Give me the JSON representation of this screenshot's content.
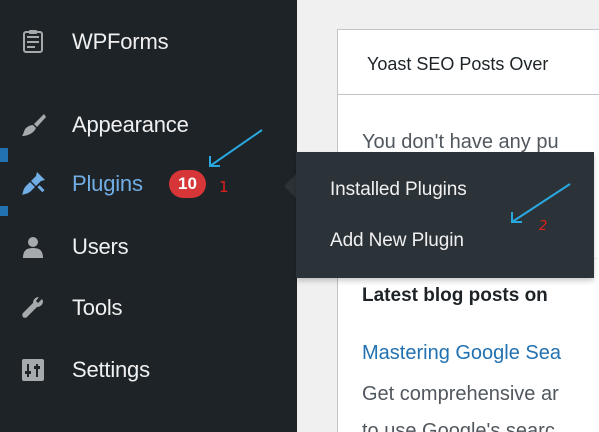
{
  "sidebar": {
    "items": [
      {
        "name": "wpforms",
        "label": "WPForms",
        "icon": "wpforms-icon"
      },
      {
        "name": "appearance",
        "label": "Appearance",
        "icon": "paintbrush-icon"
      },
      {
        "name": "plugins",
        "label": "Plugins",
        "icon": "plugin-icon",
        "badge": "10"
      },
      {
        "name": "users",
        "label": "Users",
        "icon": "user-icon"
      },
      {
        "name": "tools",
        "label": "Tools",
        "icon": "wrench-icon"
      },
      {
        "name": "settings",
        "label": "Settings",
        "icon": "settings-sliders-icon"
      }
    ]
  },
  "flyout": {
    "items": [
      {
        "label": "Installed Plugins"
      },
      {
        "label": "Add New Plugin"
      }
    ]
  },
  "card": {
    "title": "Yoast SEO Posts Over",
    "empty_message": "You don't have any pu",
    "blog_heading": "Latest blog posts on",
    "blog_link": "Mastering Google Sea",
    "blog_excerpt_1": "Get comprehensive ar",
    "blog_excerpt_2": "to use Google's searc"
  },
  "annotations": {
    "step1_label": "1",
    "step2_label": "2",
    "arrow_color": "#29a8e0",
    "number_color": "#e0201c"
  },
  "colors": {
    "sidebar_bg": "#1d2327",
    "current_text": "#72aee6",
    "current_bar": "#2271b1",
    "badge_bg": "#d63638",
    "flyout_bg": "#2c3338"
  }
}
